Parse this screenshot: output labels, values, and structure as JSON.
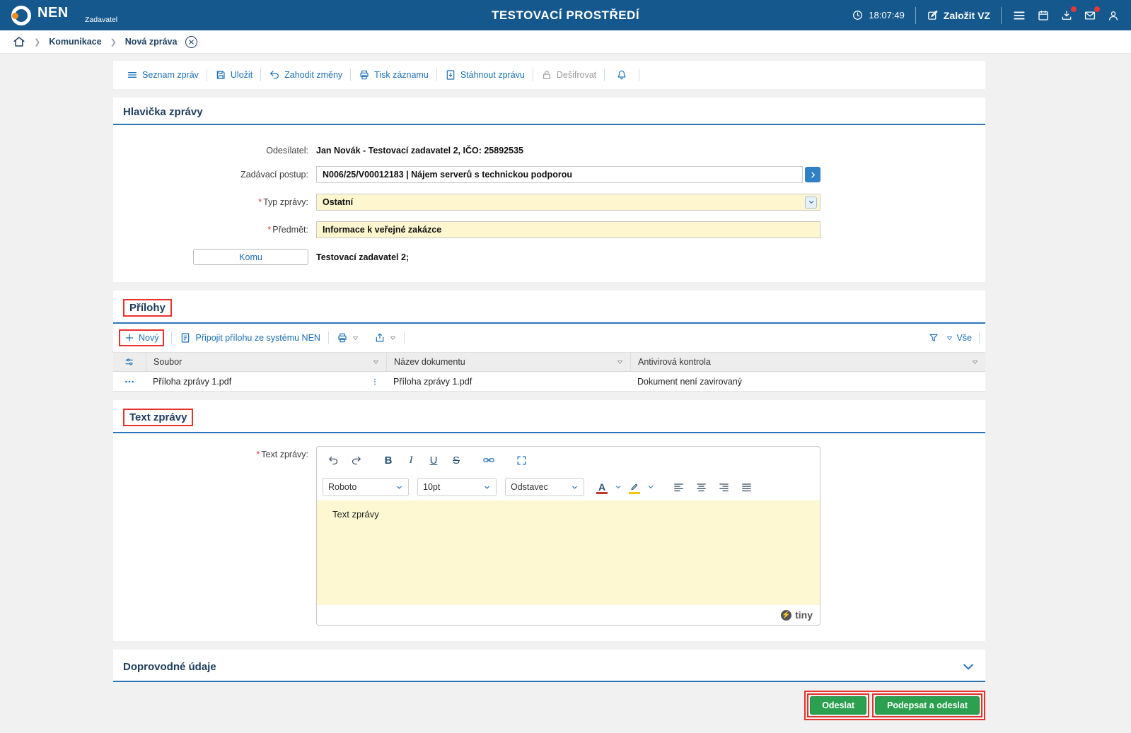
{
  "colors": {
    "header_bg": "#15588e",
    "link_blue": "#1b6fb5",
    "title_navy": "#1d3c5c",
    "field_yellow": "#fdf6cf",
    "annotation_red": "#e8322e",
    "button_green": "#2ba04f",
    "badge_red": "#e53935"
  },
  "header": {
    "brand": "NEN",
    "brand_sub": "Zadavatel",
    "env_title": "TESTOVACÍ PROSTŘEDÍ",
    "time": "18:07:49",
    "create_vz_label": "Založit VZ"
  },
  "breadcrumb": {
    "level1": "Komunikace",
    "level2": "Nová zpráva"
  },
  "toolbar": {
    "items": [
      "Seznam zpráv",
      "Uložit",
      "Zahodit změny",
      "Tisk záznamu",
      "Stáhnout zprávu",
      "Dešifrovat"
    ]
  },
  "ui": {
    "required_marker": "*"
  },
  "message_header": {
    "title": "Hlavička zprávy",
    "odesilatel_label": "Odesílatel:",
    "odesilatel_value": "Jan Novák - Testovací zadavatel 2, IČO: 25892535",
    "zadavaci_postup_label": "Zadávací postup:",
    "zadavaci_postup_value": "N006/25/V00012183 | Nájem serverů s technickou podporou",
    "typ_zpravy_label": "Typ zprávy:",
    "typ_zpravy_value": "Ostatní",
    "predmet_label": "Předmět:",
    "predmet_value": "Informace k veřejné zakázce",
    "komu_button": "Komu",
    "komu_value": "Testovací zadavatel 2;"
  },
  "attachments": {
    "title": "Přílohy",
    "new_button": "Nový",
    "attach_button": "Připojit přílohu ze systému NEN",
    "filter_all": "Vše",
    "columns": [
      "Soubor",
      "Název dokumentu",
      "Antivirová kontrola"
    ],
    "rows": [
      {
        "soubor": "Příloha zprávy 1.pdf",
        "nazev_dokumentu": "Příloha zprávy 1.pdf",
        "antivirova_kontrola": "Dokument není zavirovaný"
      }
    ]
  },
  "message_text": {
    "title": "Text zprávy",
    "label": "Text zprávy:",
    "editor": {
      "font": "Roboto",
      "size": "10pt",
      "block": "Odstavec",
      "content": "Text zprávy",
      "brand": "tiny",
      "icons": {
        "bold": "B",
        "italic": "I",
        "underline": "U",
        "strikethrough": "S"
      }
    }
  },
  "additional_section": {
    "title": "Doprovodné údaje"
  },
  "footer": {
    "send": "Odeslat",
    "sign_send": "Podepsat a odeslat"
  }
}
